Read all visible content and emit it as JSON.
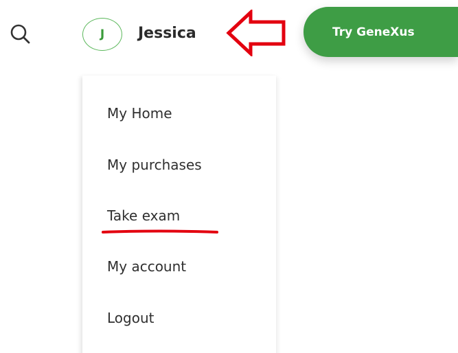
{
  "header": {
    "search_icon": "search-icon",
    "user": {
      "initial": "J",
      "name": "Jessica"
    },
    "cta_label": "Try GeneXus"
  },
  "menu": {
    "items": [
      {
        "label": "My Home"
      },
      {
        "label": "My purchases"
      },
      {
        "label": "Take exam"
      },
      {
        "label": "My account"
      },
      {
        "label": "Logout"
      }
    ]
  },
  "annotations": {
    "arrow_color": "#e3000f",
    "underline_color": "#e3000f"
  },
  "colors": {
    "brand_green": "#3e9d45",
    "avatar_border": "#5cb85c"
  }
}
